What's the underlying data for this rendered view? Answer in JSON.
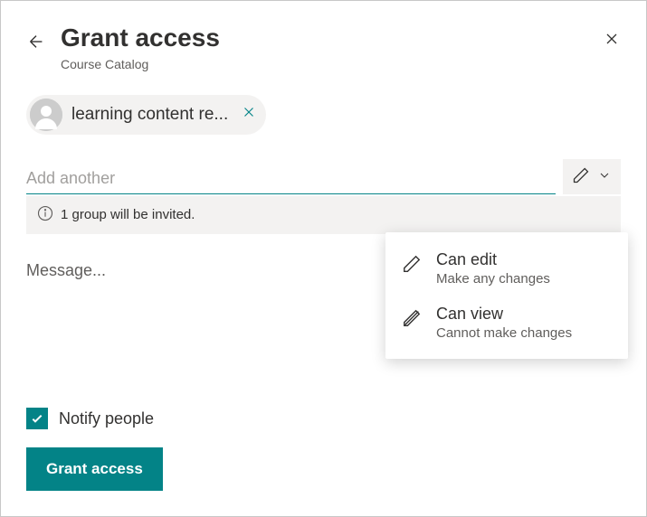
{
  "header": {
    "title": "Grant access",
    "subtitle": "Course Catalog"
  },
  "people_chip": {
    "name": "learning content re..."
  },
  "add_input": {
    "placeholder": "Add another"
  },
  "info_banner": {
    "text": "1 group will be invited."
  },
  "message": {
    "placeholder": "Message..."
  },
  "notify": {
    "label": "Notify people"
  },
  "primary_button": {
    "label": "Grant access"
  },
  "permissions_menu": {
    "items": [
      {
        "title": "Can edit",
        "desc": "Make any changes"
      },
      {
        "title": "Can view",
        "desc": "Cannot make changes"
      }
    ]
  }
}
